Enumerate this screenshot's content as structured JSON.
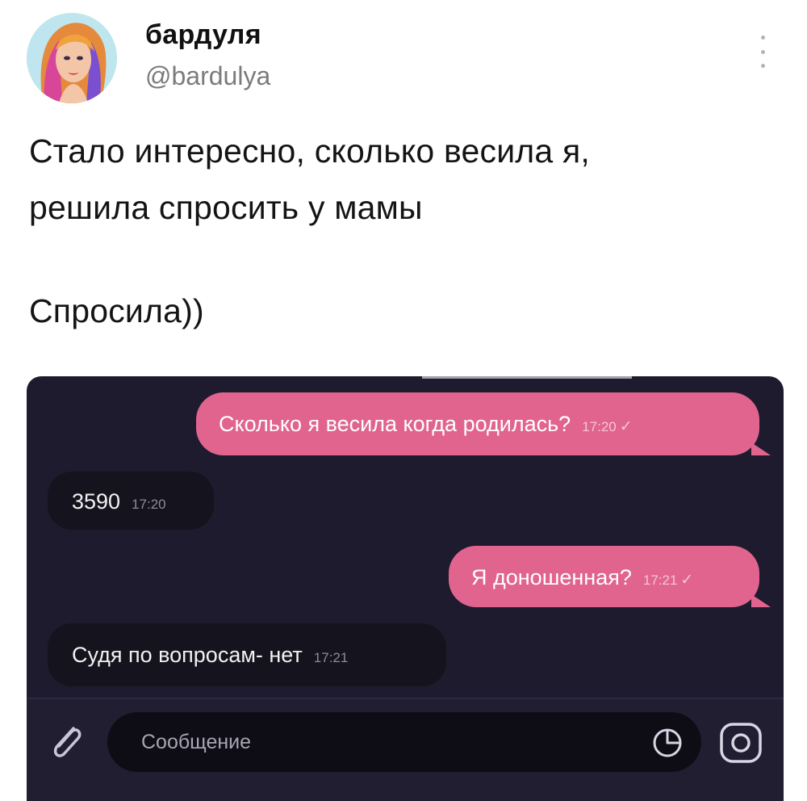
{
  "tweet": {
    "display_name": "бардуля",
    "handle": "@bardulya",
    "lines": [
      "Стало интересно, сколько весила я,",
      "решила спросить у мамы",
      "Спросила))"
    ]
  },
  "chat": {
    "messages": [
      {
        "direction": "outgoing",
        "text": "Сколько я весила когда родилась?",
        "time": "17:20",
        "status": "✓"
      },
      {
        "direction": "incoming",
        "text": "3590",
        "time": "17:20"
      },
      {
        "direction": "outgoing",
        "text": "Я доношенная?",
        "time": "17:21",
        "status": "✓"
      },
      {
        "direction": "incoming",
        "text": "Судя по вопросам- нет",
        "time": "17:21"
      }
    ],
    "composer": {
      "placeholder": "Сообщение",
      "icons": [
        "paperclip-icon",
        "sticker-icon",
        "camera-icon"
      ]
    },
    "colors": {
      "background": "#1f1b2e",
      "outgoing_bubble": "#e1648e",
      "incoming_bubble": "#15131d"
    }
  }
}
